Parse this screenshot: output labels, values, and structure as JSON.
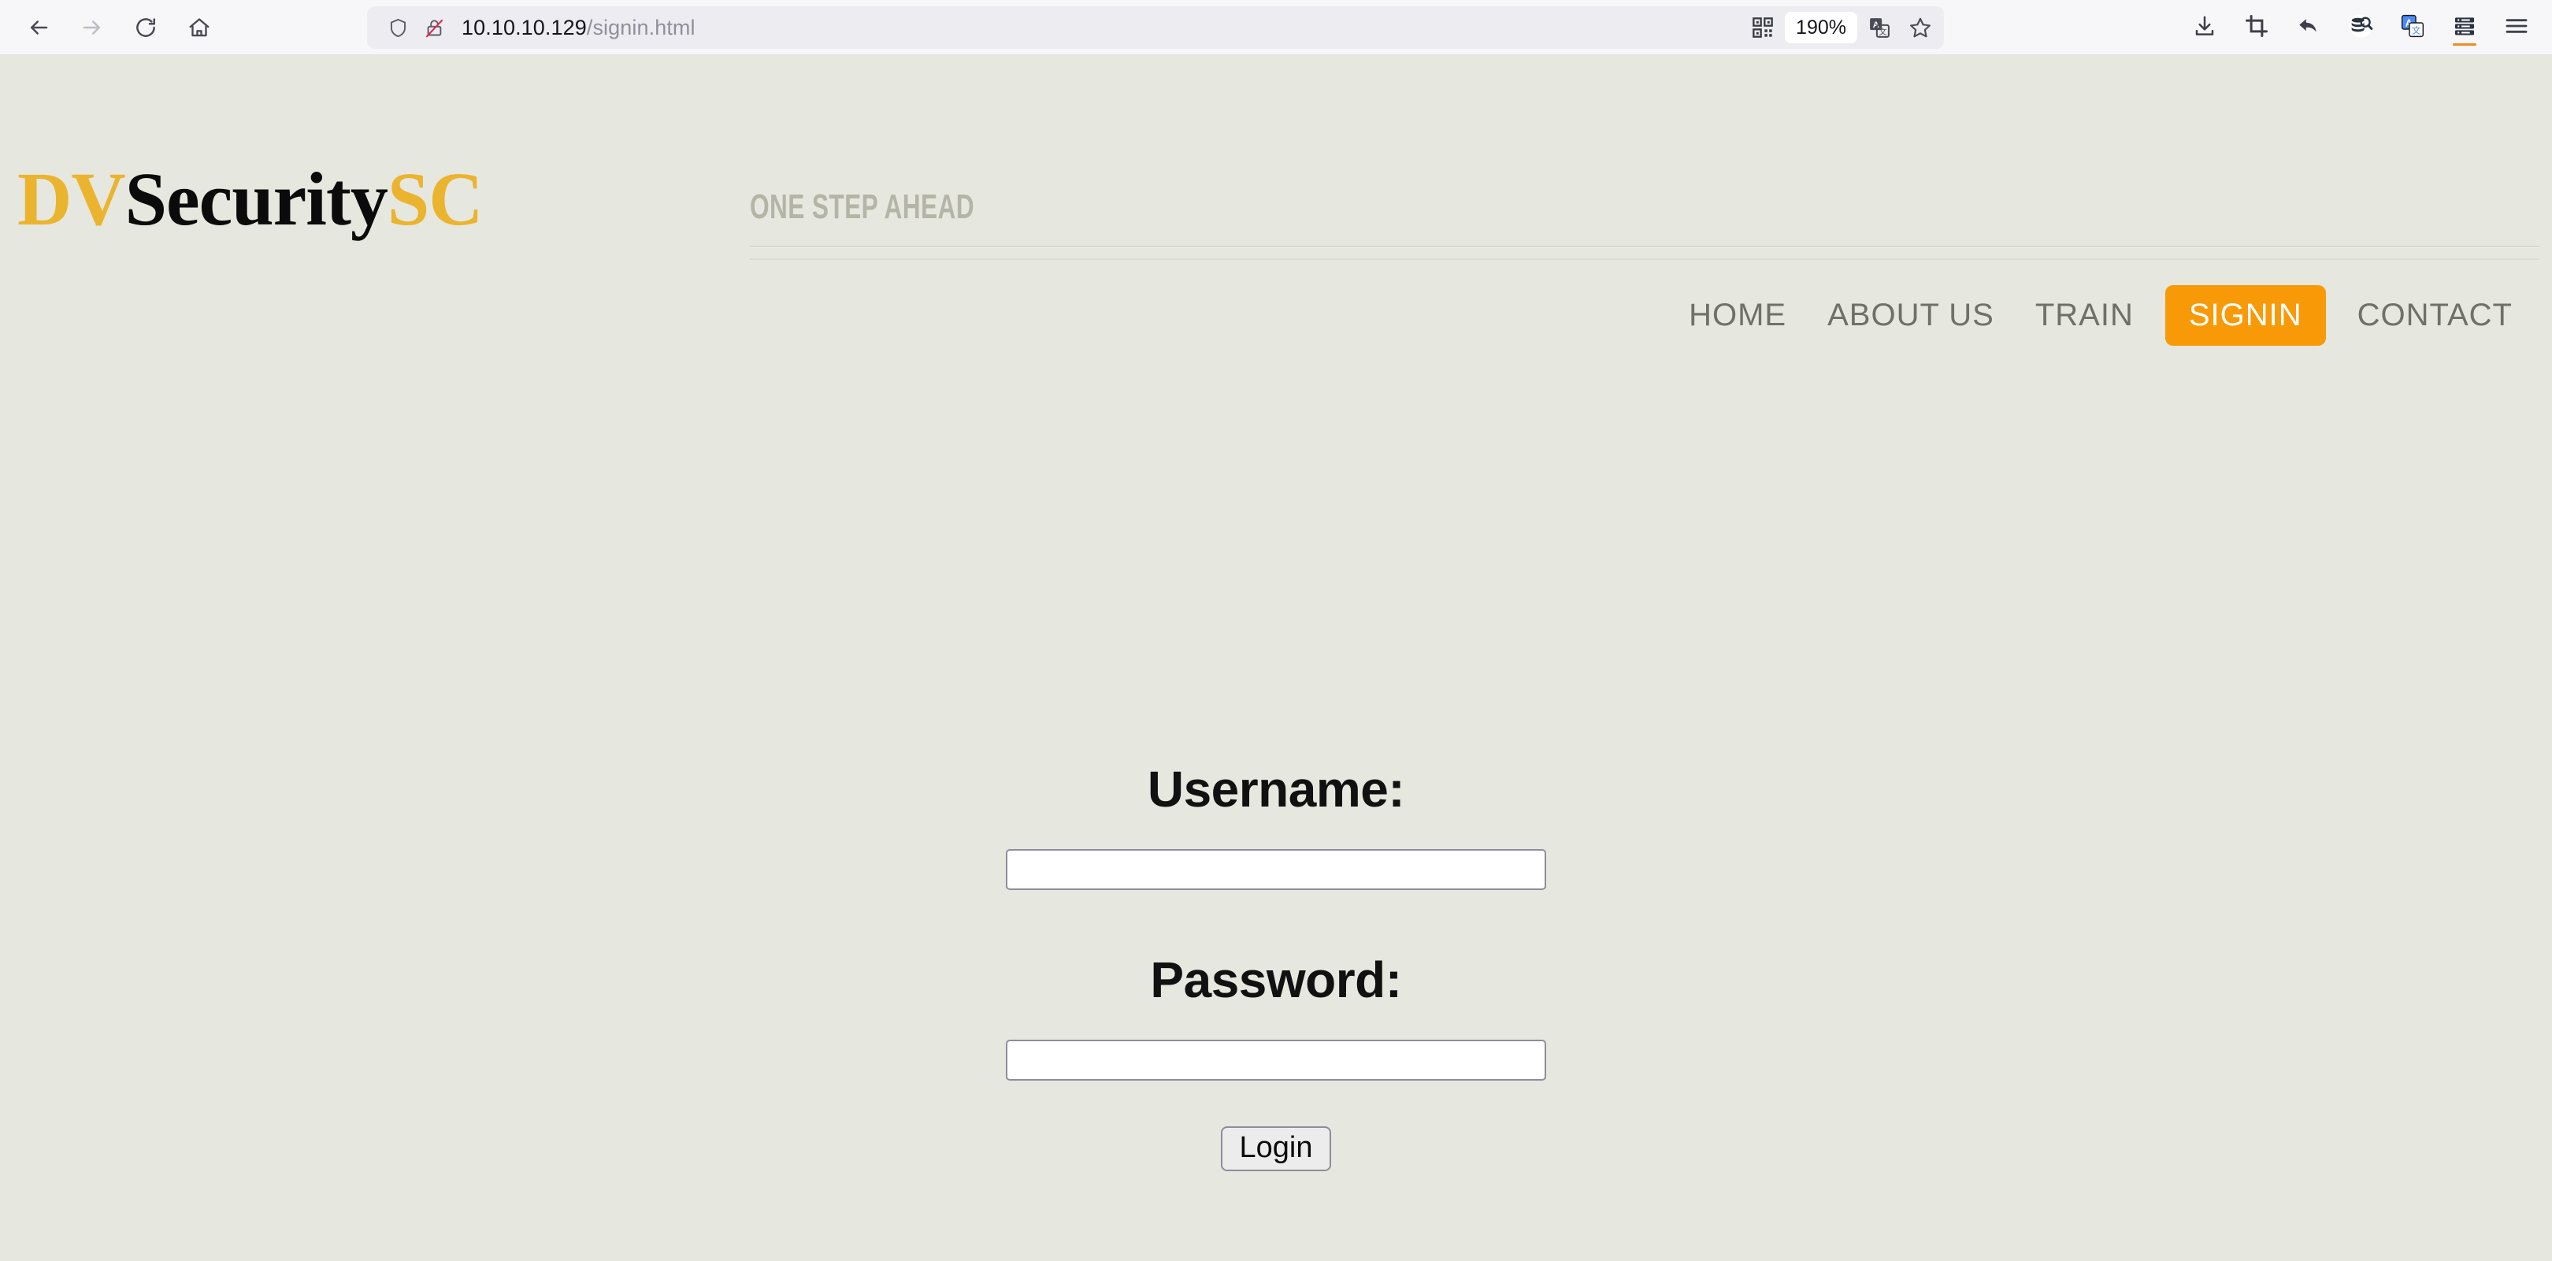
{
  "browser": {
    "back_label": "Back",
    "forward_label": "Forward",
    "reload_label": "Reload",
    "home_label": "Home",
    "url_host": "10.10.10.129",
    "url_path": "/signin.html",
    "shield_label": "Tracking protection",
    "insecure_label": "Connection is not secure",
    "qr_label": "QR code",
    "zoom_level": "190%",
    "translate_label": "Translate page",
    "bookmark_label": "Bookmark this page",
    "downloads_label": "Downloads",
    "screenshot_label": "Screenshot",
    "undo_label": "Undo close tab",
    "search_db_label": "Search database",
    "translate_ext_label": "Translate",
    "server_label": "Server tools",
    "menu_label": "Open application menu"
  },
  "site": {
    "logo": {
      "prefix": "DV",
      "middle": "Security",
      "suffix": "SC"
    },
    "tagline": "ONE STEP AHEAD",
    "nav": [
      {
        "label": "HOME",
        "active": false
      },
      {
        "label": "ABOUT US",
        "active": false
      },
      {
        "label": "TRAIN",
        "active": false
      },
      {
        "label": "SIGNIN",
        "active": true
      },
      {
        "label": "CONTACT",
        "active": false
      }
    ]
  },
  "form": {
    "username_label": "Username:",
    "username_value": "",
    "username_placeholder": "",
    "password_label": "Password:",
    "password_value": "",
    "password_placeholder": "",
    "submit_label": "Login"
  },
  "colors": {
    "page_background": "#e6e7df",
    "accent_orange": "#f89a07",
    "logo_gold": "#eab42f",
    "nav_text": "#6f7169",
    "tagline_gray": "#b4b5a6",
    "input_border": "#8f8c9c",
    "chrome_background": "#f7f7f9"
  }
}
